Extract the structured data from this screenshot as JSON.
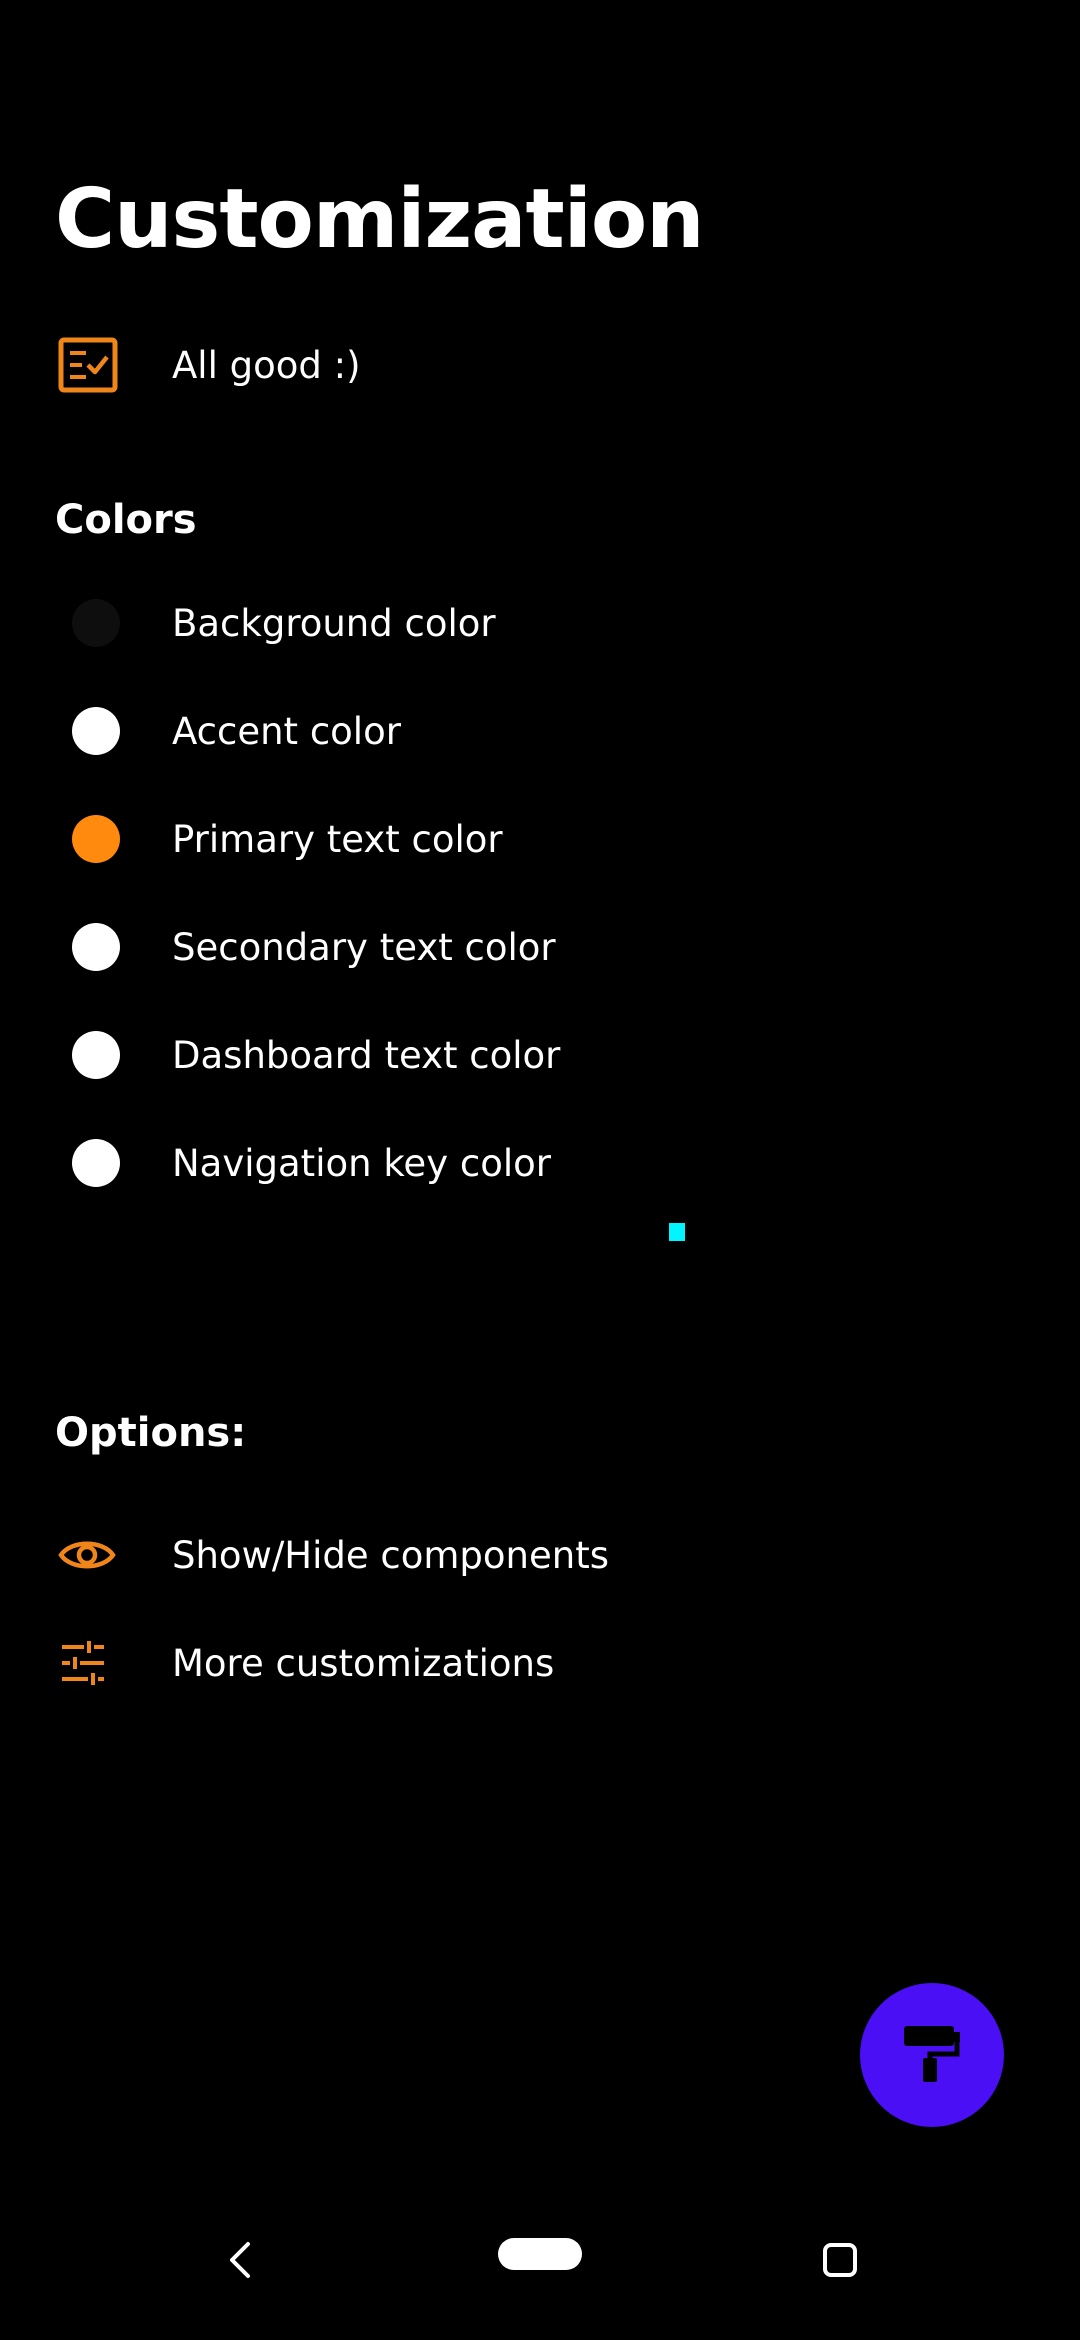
{
  "header": {
    "title": "Customization"
  },
  "status": {
    "label": "All good :)",
    "icon": "checklist-icon"
  },
  "colors_section": {
    "title": "Colors",
    "items": [
      {
        "label": "Background color",
        "swatch": "#0e0e0e"
      },
      {
        "label": "Accent color",
        "swatch": "#ffffff"
      },
      {
        "label": "Primary text color",
        "swatch": "#ff8a0d"
      },
      {
        "label": "Secondary text color",
        "swatch": "#ffffff"
      },
      {
        "label": "Dashboard text color",
        "swatch": "#ffffff"
      },
      {
        "label": "Navigation key color",
        "swatch": "#ffffff"
      }
    ]
  },
  "options_section": {
    "title": "Options:",
    "items": [
      {
        "label": "Show/Hide components",
        "icon": "eye-icon"
      },
      {
        "label": "More customizations",
        "icon": "sliders-icon"
      }
    ]
  },
  "fab": {
    "icon": "paint-roller-icon",
    "color": "#4a0ff5"
  },
  "theme": {
    "accent": "#f0861a",
    "background": "#000000",
    "marker": "#00f5ff"
  },
  "nav": {
    "back": "back-icon",
    "home": "home-pill-icon",
    "recents": "recents-icon"
  }
}
